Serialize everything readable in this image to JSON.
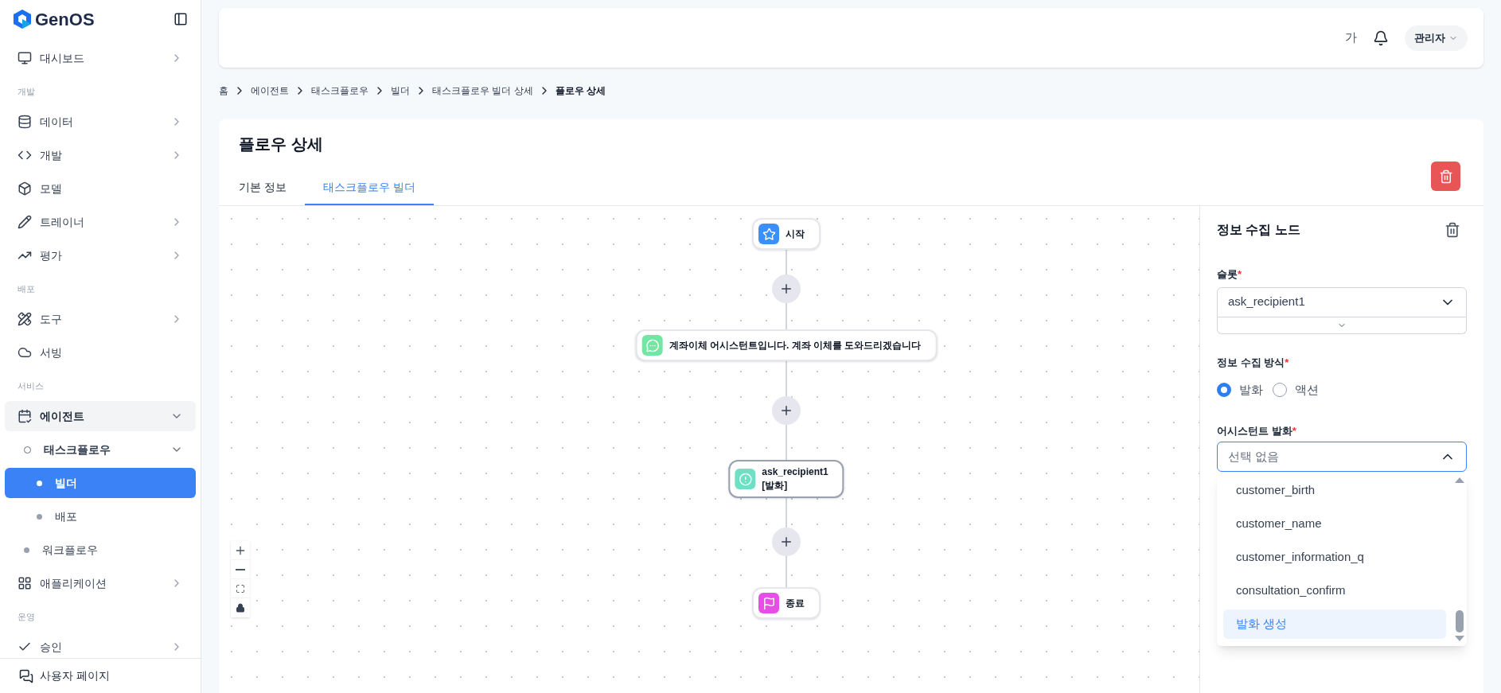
{
  "sidebar": {
    "logo": "GenOS",
    "items": [
      {
        "kind": "group",
        "label": "대시보드",
        "expanded": false
      },
      {
        "kind": "section",
        "label": "개발"
      },
      {
        "kind": "group",
        "label": "데이터",
        "expanded": false
      },
      {
        "kind": "group",
        "label": "개발",
        "expanded": false
      },
      {
        "kind": "link",
        "label": "모델"
      },
      {
        "kind": "group",
        "label": "트레이너",
        "expanded": false
      },
      {
        "kind": "group",
        "label": "평가",
        "expanded": false
      },
      {
        "kind": "section",
        "label": "배포"
      },
      {
        "kind": "group",
        "label": "도구",
        "expanded": false
      },
      {
        "kind": "link",
        "label": "서빙"
      },
      {
        "kind": "section",
        "label": "서비스"
      },
      {
        "kind": "group",
        "label": "에이전트",
        "expanded": true,
        "children": [
          {
            "kind": "group",
            "label": "태스크플로우",
            "expanded": true,
            "children": [
              {
                "kind": "link",
                "label": "빌더",
                "selected": true
              },
              {
                "kind": "link",
                "label": "배포",
                "selected": false
              }
            ]
          },
          {
            "kind": "link",
            "label": "워크플로우",
            "selected": false
          }
        ]
      },
      {
        "kind": "group",
        "label": "애플리케이션",
        "expanded": false
      },
      {
        "kind": "section",
        "label": "운영"
      },
      {
        "kind": "group",
        "label": "승인",
        "expanded": false
      }
    ],
    "footer": "사용자 페이지"
  },
  "header": {
    "font_toggle": "가",
    "user": "관리자"
  },
  "breadcrumb": [
    "홈",
    "에이전트",
    "태스크플로우",
    "빌더",
    "태스크플로우 빌더 상세",
    "플로우 상세"
  ],
  "page": {
    "title": "플로우 상세",
    "tabs": [
      {
        "label": "기본 정보",
        "selected": false
      },
      {
        "label": "태스크플로우 빌더",
        "selected": true
      }
    ]
  },
  "flow": {
    "nodes": [
      {
        "kind": "start",
        "label": "시작"
      },
      {
        "kind": "message",
        "label": "계좌이체 어시스턴트입니다. 계좌 이체를 도와드리겠습니다"
      },
      {
        "kind": "slot",
        "label": "ask_recipient1",
        "sublabel": "[발화]"
      },
      {
        "kind": "end",
        "label": "종료"
      }
    ]
  },
  "panel": {
    "title": "정보 수집 노드",
    "slot": {
      "label": "슬롯",
      "required_mark": "*",
      "value": "ask_recipient1"
    },
    "method": {
      "label": "정보 수집 방식",
      "required_mark": "*",
      "options": [
        {
          "label": "발화",
          "selected": true
        },
        {
          "label": "액션",
          "selected": false
        }
      ]
    },
    "utterance": {
      "label": "어시스턴트 발화",
      "required_mark": "*",
      "placeholder": "선택 없음",
      "expanded": true,
      "options": [
        {
          "label": "customer_birth",
          "selected": false
        },
        {
          "label": "customer_name",
          "selected": false
        },
        {
          "label": "customer_information_q",
          "selected": false
        },
        {
          "label": "consultation_confirm",
          "selected": false
        },
        {
          "label": "발화 생성",
          "selected": true
        }
      ]
    }
  }
}
